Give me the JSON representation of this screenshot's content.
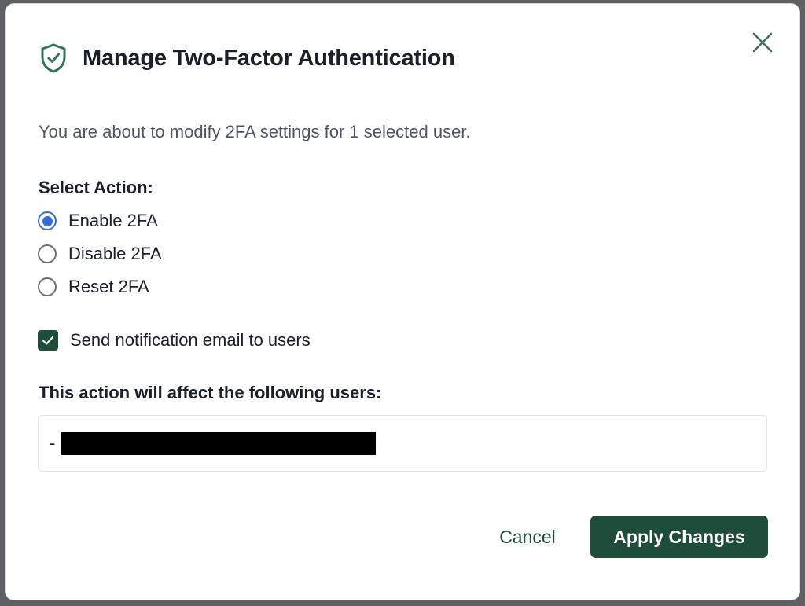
{
  "modal": {
    "title": "Manage Two-Factor Authentication",
    "description": "You are about to modify 2FA settings for 1 selected user.",
    "action_label": "Select Action:",
    "options": [
      {
        "label": "Enable 2FA",
        "checked": true
      },
      {
        "label": "Disable 2FA",
        "checked": false
      },
      {
        "label": "Reset 2FA",
        "checked": false
      }
    ],
    "notify": {
      "label": "Send notification email to users",
      "checked": true
    },
    "affected_label": "This action will affect the following users:",
    "affected_users": [
      {
        "prefix": "-",
        "name": "[redacted]"
      }
    ],
    "cancel_label": "Cancel",
    "apply_label": "Apply Changes"
  },
  "icons": {
    "header": "shield-check-icon",
    "close": "close-icon",
    "checkbox": "checkmark-icon"
  },
  "colors": {
    "accent": "#1e4d3a",
    "radio_selected": "#2f6de1",
    "title_text": "#1b1f2a",
    "muted_text": "#4f5560"
  }
}
